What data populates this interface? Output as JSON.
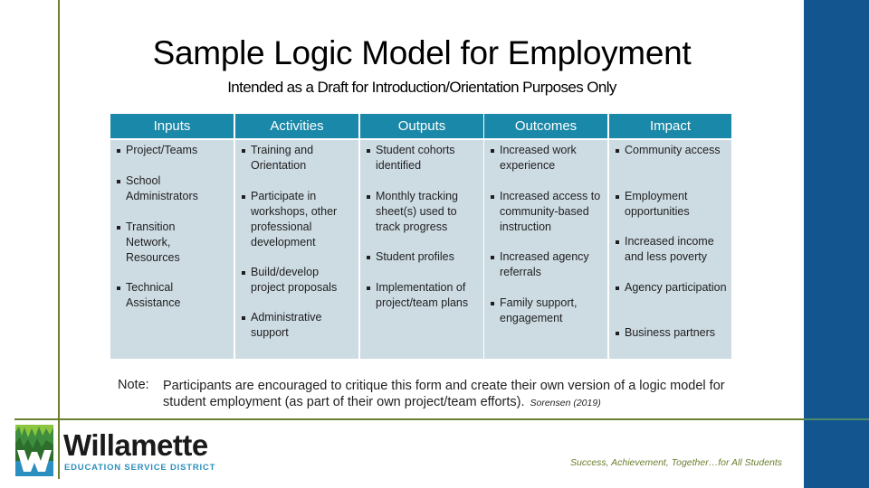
{
  "title": "Sample Logic Model for Employment",
  "subtitle": "Intended as a Draft for Introduction/Orientation Purposes Only",
  "columns": [
    {
      "header": "Inputs",
      "items": [
        "Project/Teams",
        "School Administrators",
        "Transition Network, Resources",
        "Technical Assistance"
      ]
    },
    {
      "header": "Activities",
      "items": [
        "Training and Orientation",
        "Participate in workshops, other professional development",
        "Build/develop project proposals",
        "Administrative support"
      ]
    },
    {
      "header": "Outputs",
      "items": [
        "Student cohorts identified",
        "Monthly tracking sheet(s) used to track progress",
        "Student profiles",
        "Implementation of project/team plans"
      ]
    },
    {
      "header": "Outcomes",
      "items": [
        "Increased work experience",
        "Increased access to community-based instruction",
        "Increased agency referrals",
        "Family support, engagement"
      ]
    },
    {
      "header": "Impact",
      "items": [
        "Community access",
        "Employment opportunities",
        "Increased income and less poverty",
        "Agency participation",
        "Business partners"
      ]
    }
  ],
  "note": {
    "label": "Note:",
    "text": "Participants are encouraged to critique this form and create their own version of a logic model for student employment (as part of their own project/team efforts).",
    "citation": "Sorensen (2019)"
  },
  "footer": {
    "logo_name": "Willamette",
    "logo_subtitle": "EDUCATION SERVICE DISTRICT",
    "tagline": "Success, Achievement, Together…for All Students"
  },
  "colors": {
    "header": "#1a88a8",
    "cell": "#cddbe3",
    "sidebar": "#13568f",
    "accent_line": "#6b7f2f"
  }
}
